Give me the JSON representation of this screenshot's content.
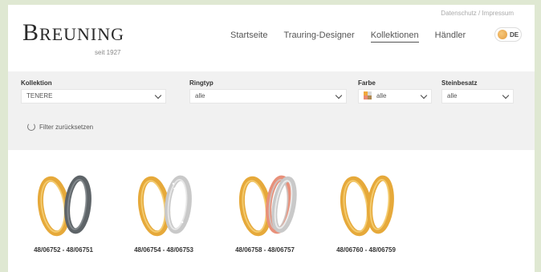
{
  "header": {
    "meta_links": "Datenschutz / Impressum",
    "logo_initial": "B",
    "logo_rest": "REUNING",
    "logo_since": "seit 1927",
    "nav": [
      "Startseite",
      "Trauring-Designer",
      "Kollektionen",
      "Händler"
    ],
    "active_nav": "Kollektionen",
    "language": "DE"
  },
  "filters": {
    "kollektion": {
      "label": "Kollektion",
      "value": "TENERE"
    },
    "ringtyp": {
      "label": "Ringtyp",
      "value": "alle"
    },
    "farbe": {
      "label": "Farbe",
      "value": "alle"
    },
    "steinbesatz": {
      "label": "Steinbesatz",
      "value": "alle"
    },
    "reset_label": "Filter zurücksetzen"
  },
  "products": [
    {
      "code": "48/06752 - 48/06751",
      "second_ring": "dark-gray",
      "icon": "ring-pair-icon"
    },
    {
      "code": "48/06754 - 48/06753",
      "second_ring": "diamond-silver",
      "icon": "ring-pair-icon"
    },
    {
      "code": "48/06758 - 48/06757",
      "second_ring": "tricolor",
      "icon": "ring-pair-icon"
    },
    {
      "code": "48/06760 - 48/06759",
      "second_ring": "gold",
      "icon": "ring-pair-icon"
    }
  ],
  "colors": {
    "gold": "#e6a93a",
    "gold_light": "#f6d27a",
    "silver": "#c9c9c9",
    "rose": "#e8907a",
    "dark": "#5e6468",
    "filter_bg": "#f1f1f1",
    "page_bg": "#dfe8d2"
  }
}
